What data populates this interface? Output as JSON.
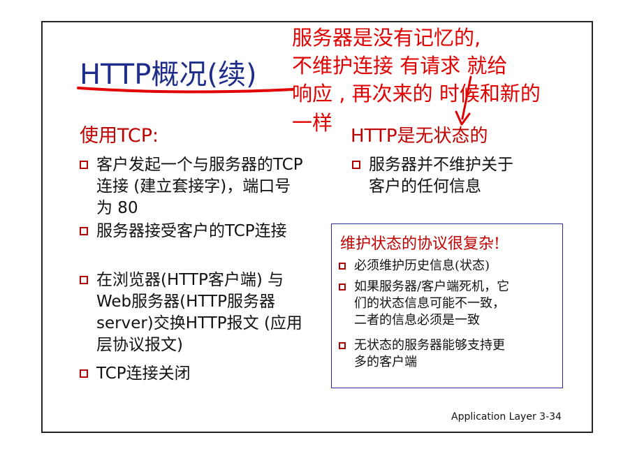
{
  "slide": {
    "title": "HTTP概况(续)",
    "left_heading": "使用TCP:",
    "left_bullets": [
      "客户发起一个与服务器的TCP连接 (建立套接字)，端口号为 80",
      "服务器接受客户的TCP连接",
      "在浏览器(HTTP客户端) 与 Web服务器(HTTP服务器 server)交换HTTP报文 (应用层协议报文)",
      "TCP连接关闭"
    ],
    "right_heading": "HTTP是无状态的",
    "right_bullet": "服务器并不维护关于客户的任何信息",
    "annotation_lines": [
      "服务器是没有记忆的,",
      "不维护连接 有请求 就给",
      "响应 , 再次来的 时候和新的",
      "一样"
    ],
    "box": {
      "heading": "维护状态的协议很复杂!",
      "bullets": [
        "必须维护历史信息(状态)",
        "如果服务器/客户端死机，它\n们的状态信息可能不一致，\n二者的信息必须是一致",
        "无状态的服务器能够支持更\n多的客户端"
      ]
    },
    "footer": "Application Layer   3-34"
  },
  "colors": {
    "title": "#1f2d8a",
    "heading_red": "#c00000",
    "annotation_red": "#e00000",
    "box_border": "#2a2aa0"
  }
}
